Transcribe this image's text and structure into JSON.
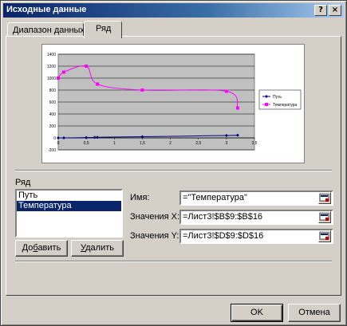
{
  "window": {
    "title": "Исходные данные",
    "help_button": "?",
    "close_button": "×"
  },
  "tabs": [
    {
      "label": "Диапазон данных",
      "active": false
    },
    {
      "label": "Ряд",
      "active": true
    }
  ],
  "chart_data": {
    "type": "scatter",
    "y_ticks": [
      "1400",
      "1200",
      "1000",
      "800",
      "600",
      "400",
      "200",
      "0",
      "-200"
    ],
    "x_ticks": [
      "0",
      "0,5",
      "1",
      "1,5",
      "2",
      "2,5",
      "3",
      "3,5"
    ],
    "xlim": [
      0,
      3.5
    ],
    "ylim": [
      -200,
      1400
    ],
    "grid": true,
    "plot_background": "#c0c0c0",
    "legend_position": "right",
    "series": [
      {
        "name": "Путь",
        "color": "#000080",
        "marker": "diamond",
        "x": [
          0,
          0.1,
          0.5,
          0.65,
          0.7,
          1.5,
          3.0,
          3.2
        ],
        "y": [
          0,
          0,
          5,
          8,
          10,
          20,
          40,
          45
        ]
      },
      {
        "name": "Температура",
        "color": "#ff00ff",
        "marker": "square",
        "x": [
          0,
          0.1,
          0.5,
          0.7,
          1.5,
          3.0,
          3.2
        ],
        "y": [
          1000,
          1100,
          1200,
          900,
          800,
          780,
          500
        ]
      }
    ]
  },
  "series_group": {
    "label": "Ряд",
    "items": [
      "Путь",
      "Температура"
    ],
    "selected_index": 1,
    "add_button": "Добавить",
    "add_accel": "б",
    "delete_button": "Удалить",
    "delete_accel": "У"
  },
  "fields": {
    "name_label": "Имя:",
    "name_value": "=\"Температура\"",
    "x_label": "Значения X:",
    "x_value": "=Лист3!$B$9:$B$16",
    "y_label": "Значения Y:",
    "y_value": "=Лист3!$D$9:$D$16"
  },
  "footer": {
    "ok_button": "OK",
    "cancel_button": "Отмена"
  }
}
